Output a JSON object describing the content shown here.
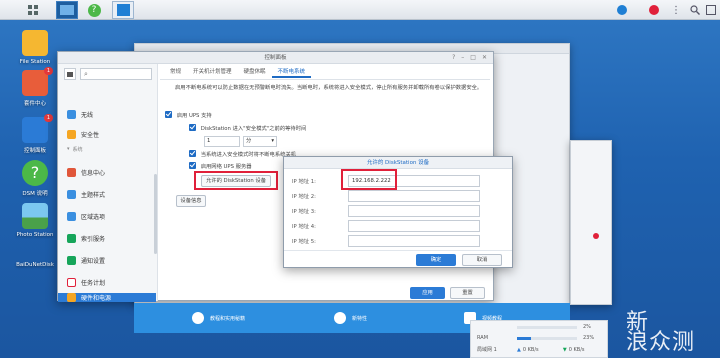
{
  "taskbar": {
    "notif_count": "",
    "user_badge": ""
  },
  "desktop": {
    "icons": [
      {
        "label": "File Station"
      },
      {
        "label": "套件中心",
        "badge": "1"
      },
      {
        "label": "控制面板",
        "badge": "1"
      },
      {
        "label": "DSM 说明"
      },
      {
        "label": "Photo Station"
      },
      {
        "label": "BaiDuNetDisk"
      }
    ]
  },
  "control_panel": {
    "title": "控制面板",
    "search_placeholder": "",
    "sidebar": {
      "items": [
        {
          "label": "无线",
          "color": "#3a8fe0"
        },
        {
          "label": "安全性",
          "color": "#f5a623"
        },
        {
          "label": "系统",
          "color": "#888888"
        },
        {
          "label": "信息中心",
          "color": "#e0563a"
        },
        {
          "label": "主题样式",
          "color": "#3a8fe0"
        },
        {
          "label": "区域选项",
          "color": "#3a8fe0"
        },
        {
          "label": "索引服务",
          "color": "#16a55a"
        },
        {
          "label": "通知设置",
          "color": "#16a55a"
        },
        {
          "label": "任务计划",
          "color": "#e0203a"
        },
        {
          "label": "硬件和电源",
          "color": "#f5a623"
        }
      ]
    },
    "tabs": [
      {
        "label": "常规"
      },
      {
        "label": "开关机计划管理"
      },
      {
        "label": "硬盘休眠"
      },
      {
        "label": "不断电系统"
      }
    ],
    "description": "启用不断电系统可以防止数据在无预警断电时流失。当断电时，系统将进入安全模式，停止所有服务并卸载所有卷以保护数据安全。",
    "options": {
      "enable_ups": "启用 UPS 支持",
      "safe_mode_time": "DiskStation 进入\"安全模式\"之前的等待时间",
      "time_value": "1",
      "time_unit": "分",
      "shutdown_ups": "当系统进入安全模式时将不断电系统关机",
      "network_ups": "启用网络 UPS 服务器",
      "allowed_button": "允许的 DiskStation 设备",
      "device_info_button": "设备信息"
    },
    "apply_label": "应用",
    "reset_label": "重置"
  },
  "dialog": {
    "title": "允许的 DiskStation 设备",
    "rows": [
      {
        "label": "IP 地址 1:",
        "value": "192.168.2.222"
      },
      {
        "label": "IP 地址 2:",
        "value": ""
      },
      {
        "label": "IP 地址 3:",
        "value": ""
      },
      {
        "label": "IP 地址 4:",
        "value": ""
      },
      {
        "label": "IP 地址 5:",
        "value": ""
      }
    ],
    "ok_label": "确定",
    "cancel_label": "取消"
  },
  "dock": {
    "items": [
      {
        "label": "教程和实用秘籍"
      },
      {
        "label": "新特性"
      },
      {
        "label": "视频教程"
      }
    ]
  },
  "widget": {
    "rows": [
      {
        "label": "",
        "value": "2%"
      },
      {
        "label": "RAM",
        "value": "23%"
      },
      {
        "label": "局域网 1",
        "up": "0 KB/s",
        "down": "0 KB/s"
      }
    ]
  },
  "watermark": "新\n浪众测"
}
